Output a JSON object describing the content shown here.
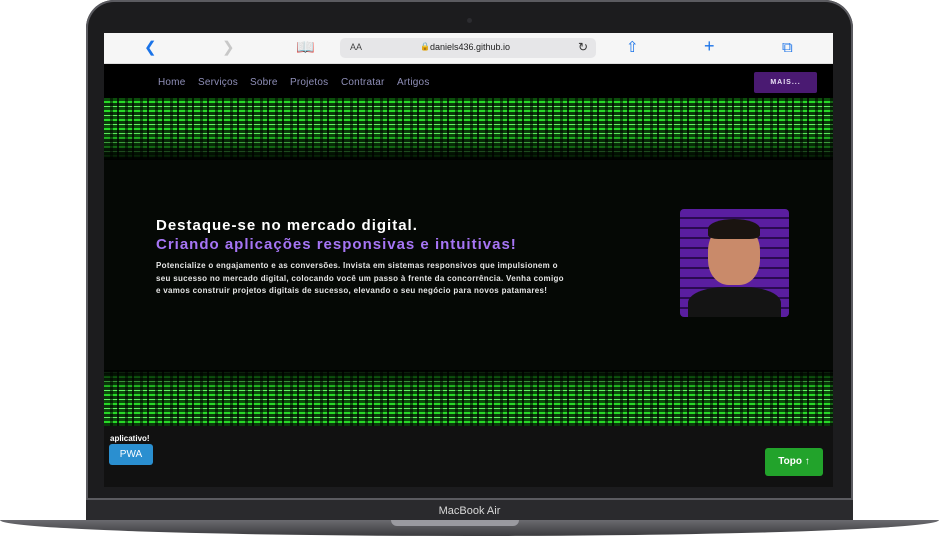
{
  "browser": {
    "url": "daniels436.github.io",
    "text_size_label": "AA",
    "back_icon": "chevron-left-icon",
    "forward_icon": "chevron-right-icon",
    "reader_icon": "book-icon",
    "lock_icon": "lock-icon",
    "reload_icon": "reload-icon",
    "share_icon": "share-icon",
    "new_tab_icon": "plus-icon",
    "tabs_icon": "tabs-icon"
  },
  "nav": {
    "items": [
      {
        "label": "Home"
      },
      {
        "label": "Serviços"
      },
      {
        "label": "Sobre"
      },
      {
        "label": "Projetos"
      },
      {
        "label": "Contratar"
      },
      {
        "label": "Artigos"
      }
    ],
    "more_label": "MAIS..."
  },
  "hero": {
    "title": "Destaque-se no mercado digital.",
    "subtitle": "Criando aplicações responsivas e intuitivas!",
    "description": "Potencialize o engajamento e as conversões. Invista em sistemas responsivos que impulsionem o seu sucesso no mercado digital, colocando você um passo à frente da concorrência. Venha comigo e vamos construir projetos digitais de sucesso, elevando o seu negócio para novos patamares!"
  },
  "pwa": {
    "label": "aplicativo!",
    "button": "PWA"
  },
  "top_button": {
    "label": "Topo ↑"
  },
  "device": {
    "model_label": "MacBook Air"
  },
  "colors": {
    "nav_link": "#8f8fb8",
    "accent_purple": "#a675f5",
    "more_button": "#4a1a72",
    "matrix_green": "#27d927",
    "pwa_button": "#2a8fd0",
    "top_button": "#22a32b"
  }
}
